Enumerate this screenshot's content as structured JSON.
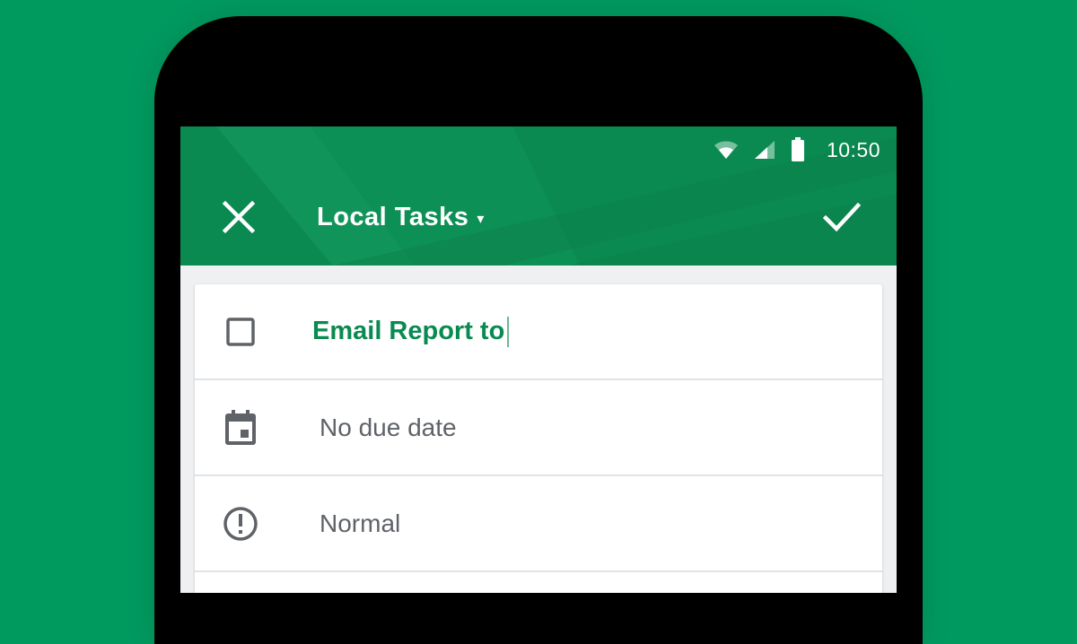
{
  "colors": {
    "background": "#009a5f",
    "appbar": "#0a8a51",
    "accent": "#0a8a51",
    "icon_gray": "#5f6368"
  },
  "status_bar": {
    "time": "10:50",
    "icons": [
      "wifi-icon",
      "signal-icon",
      "battery-icon"
    ]
  },
  "header": {
    "close_icon": "close-icon",
    "title": "Local Tasks",
    "title_caret": "▾",
    "confirm_icon": "check-icon"
  },
  "task_form": {
    "task_title": "Email Report to",
    "due_date": "No due date",
    "priority": "Normal"
  }
}
